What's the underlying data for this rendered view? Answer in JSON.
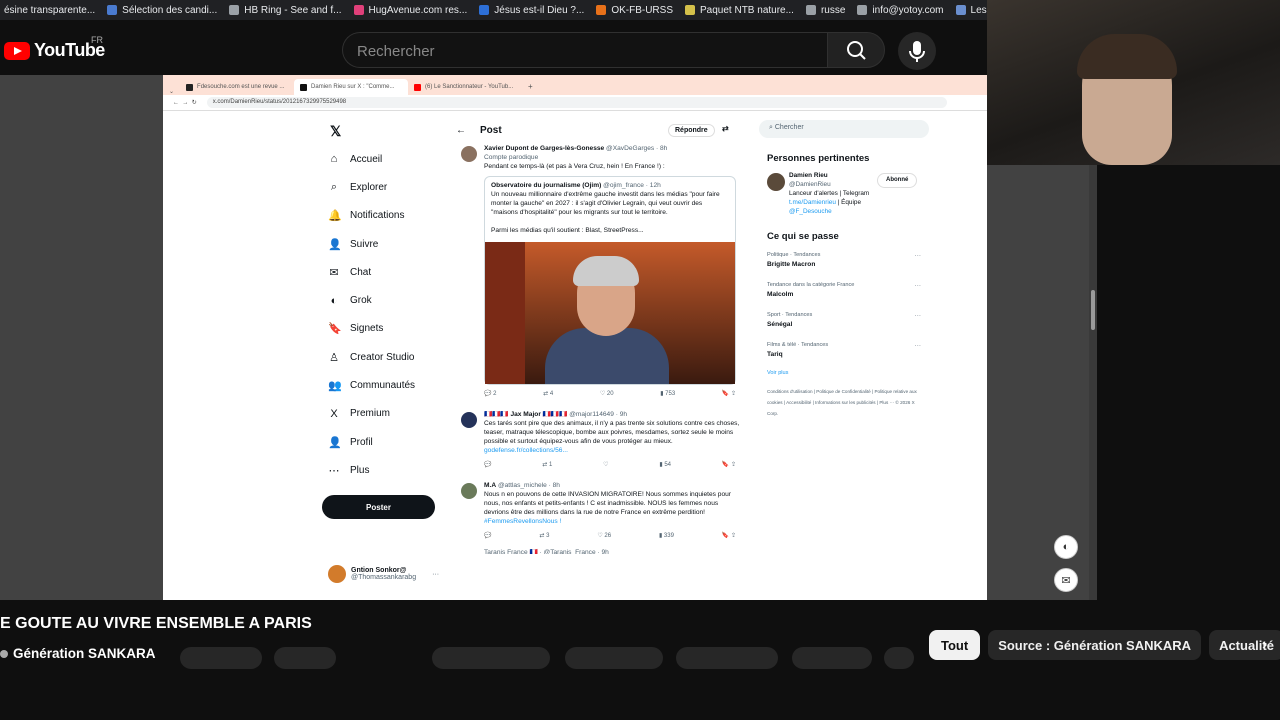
{
  "bookmarks": [
    {
      "label": "ésine transparente...",
      "color": "#444"
    },
    {
      "label": "Sélection des candi...",
      "color": "#4a7bd0"
    },
    {
      "label": "HB Ring - See and f...",
      "color": "#9aa0a6"
    },
    {
      "label": "HugAvenue.com res...",
      "color": "#e0407a"
    },
    {
      "label": "Jésus est-il Dieu ?...",
      "color": "#2d6fd6"
    },
    {
      "label": "OK-FB-URSS",
      "color": "#e8711a"
    },
    {
      "label": "Paquet NTB nature...",
      "color": "#d4c04a"
    },
    {
      "label": "russe",
      "color": "#9aa0a6"
    },
    {
      "label": "info@yotoy.com",
      "color": "#9aa0a6"
    },
    {
      "label": "Les concours d'aute...",
      "color": "#6a8fd0"
    }
  ],
  "youtube": {
    "logo_text": "YouTube",
    "country": "FR",
    "search_placeholder": "Rechercher"
  },
  "browser": {
    "tabs": [
      {
        "label": "Fdesouche.com est une revue ...",
        "color": "#222"
      },
      {
        "label": "Damien Rieu sur X : \"Comme...",
        "color": "#111"
      },
      {
        "label": "(6) Le Sanctionnateur - YouTub...",
        "color": "#f00"
      }
    ],
    "new_tab": "+",
    "url": "x.com/DamienRieu/status/2012167329975529498"
  },
  "x_nav": {
    "items": [
      {
        "icon": "⌂",
        "label": "Accueil"
      },
      {
        "icon": "⌕",
        "label": "Explorer"
      },
      {
        "icon": "🔔",
        "label": "Notifications"
      },
      {
        "icon": "👤",
        "label": "Suivre"
      },
      {
        "icon": "✉",
        "label": "Chat"
      },
      {
        "icon": "◐",
        "label": "Grok"
      },
      {
        "icon": "🔖",
        "label": "Signets"
      },
      {
        "icon": "♙",
        "label": "Creator Studio"
      },
      {
        "icon": "👥",
        "label": "Communautés"
      },
      {
        "icon": "X",
        "label": "Premium"
      },
      {
        "icon": "👤",
        "label": "Profil"
      },
      {
        "icon": "⋯",
        "label": "Plus"
      }
    ],
    "post_button": "Poster",
    "account_name": "Gntion Sonkor@",
    "account_handle": "@Thomassankarabg"
  },
  "post": {
    "header": "Post",
    "reply_button": "Répondre",
    "tweet1": {
      "name": "Xavier Dupont de Garges-lès-Gonesse",
      "handle": "@XavDeGarges · 8h",
      "tag": "Compte parodique",
      "text": "Pendant ce temps-là (et pas à Vera Cruz, hein ! En France !) :",
      "quote_name": "Observatoire du journalisme (Ojim)",
      "quote_handle": "@ojim_france · 12h",
      "quote_text": "Un nouveau millionnaire d'extrême gauche investit dans les médias \"pour faire monter la gauche\" en 2027 : il s'agit d'Olivier Legrain, qui veut ouvrir des \"maisons d'hospitalité\" pour les migrants sur tout le territoire.",
      "quote_text2": "Parmi les médias qu'il soutient : Blast, StreetPress...",
      "stats": [
        "2",
        "4",
        "20",
        "753"
      ]
    },
    "tweet2": {
      "name": "🇫🇷🇫🇷🇫🇷 Jax Major 🇫🇷🇫🇷🇫🇷",
      "handle": "@major114649 · 9h",
      "text": "Ces tarés sont pire que des animaux, il n'y a pas trente six solutions contre ces choses, teaser, matraque télescopique, bombe aux poivres, mesdames, sortez seule le moins possible et surtout équipez-vous afin de vous protéger au mieux.",
      "link": "godefense.fr/collections/56...",
      "stats": [
        "",
        "1",
        "",
        "54"
      ]
    },
    "tweet3": {
      "name": "M.A",
      "handle": "@attlas_michele · 8h",
      "text": "Nous n en pouvons de cette INVASION MIGRATOIRE! Nous sommes inquietes pour nous, nos enfants et petits-enfants ! C est inadmissible. NOUS  les femmes nous devrions être des millions dans la rue de notre France en extrême perdition!",
      "hashtag": "#FemmesRevellonsNous !",
      "stats": [
        "",
        "3",
        "26",
        "339"
      ]
    },
    "tweet4_partial": "Taranis France 🇫🇷 · @Taranis_France · 9h"
  },
  "right": {
    "search": "Chercher",
    "people_title": "Personnes pertinentes",
    "person_name": "Damien Rieu",
    "person_handle": "@DamienRieu",
    "follow_button": "Abonné",
    "person_bio": "Lanceur d'alertes | Telegram",
    "person_link": "t.me/Damienrieu",
    "person_bio2": "| Équipe",
    "person_mention": "@F_Desouche",
    "trends_title": "Ce qui se passe",
    "trends": [
      {
        "cat": "Politique · Tendances",
        "name": "Brigitte Macron"
      },
      {
        "cat": "Tendance dans la catégorie France",
        "name": "Malcolm"
      },
      {
        "cat": "Sport · Tendances",
        "name": "Sénégal"
      },
      {
        "cat": "Films & télé · Tendances",
        "name": "Tariq"
      }
    ],
    "show_more": "Voir plus",
    "footer": "Conditions d'utilisation | Politique de Confidentialité | Politique relative aux cookies | Accessibilité | Informations sur les publicités | Plus ··· © 2026 X Corp."
  },
  "bottom": {
    "video_title": "E GOUTE AU VIVRE ENSEMBLE A PARIS",
    "channel": "Génération SANKARA",
    "chips": [
      "Tout",
      "Source : Génération SANKARA",
      "Actualité"
    ]
  }
}
